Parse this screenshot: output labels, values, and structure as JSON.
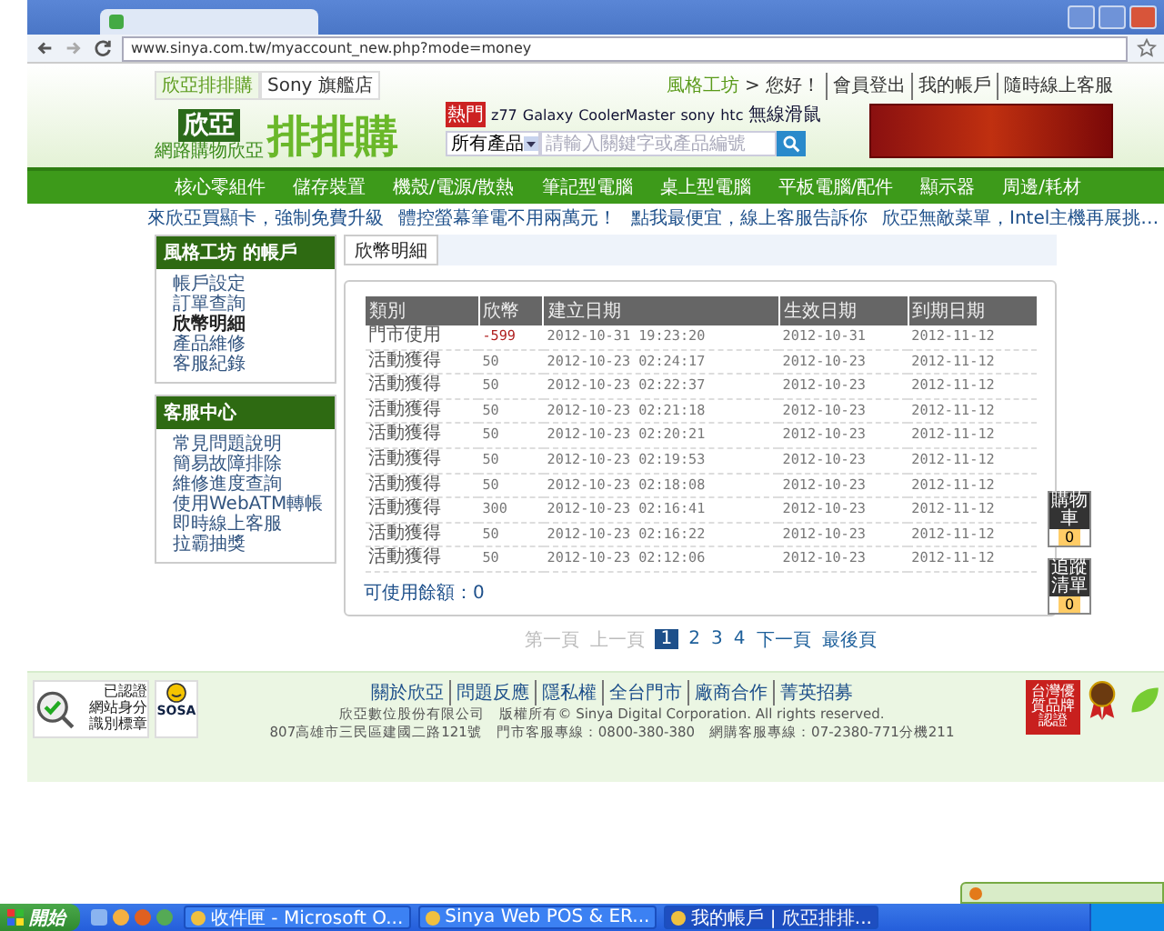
{
  "browser": {
    "url": "www.sinya.com.tw/myaccount_new.php?mode=money"
  },
  "header": {
    "store_tabs": [
      {
        "label": "欣亞排排購",
        "selected": true
      },
      {
        "label": "Sony 旗艦店",
        "selected": false
      }
    ],
    "logo": {
      "mark": "欣亞",
      "name": "排排購",
      "tagline": "網路購物欣亞"
    },
    "user_links": [
      "風格工坊",
      "> 您好！",
      "會員登出",
      "我的帳戶",
      "隨時線上客服"
    ],
    "hot_label": "熱門",
    "hot_keywords": [
      "z77",
      "Galaxy",
      "CoolerMaster",
      "sony",
      "htc",
      "無線滑鼠"
    ],
    "search": {
      "category": "所有產品",
      "placeholder": "請輸入關鍵字或產品編號"
    }
  },
  "nav": [
    "核心零組件",
    "儲存裝置",
    "機殼/電源/散熱",
    "筆記型電腦",
    "桌上型電腦",
    "平板電腦/配件",
    "顯示器",
    "周邊/耗材"
  ],
  "promos": [
    "來欣亞買顯卡，強制免費升級",
    "體控螢幕筆電不用兩萬元！",
    "點我最便宜，線上客服告訴你",
    "欣亞無敵菜單，Intel主機再展挑…"
  ],
  "sidebar": [
    {
      "title": "風格工坊 的帳戶",
      "items": [
        {
          "label": "帳戶設定",
          "selected": false
        },
        {
          "label": "訂單查詢",
          "selected": false
        },
        {
          "label": "欣幣明細",
          "selected": true
        },
        {
          "label": "產品維修",
          "selected": false
        },
        {
          "label": "客服紀錄",
          "selected": false
        }
      ]
    },
    {
      "title": "客服中心",
      "items": [
        {
          "label": "常見問題說明",
          "selected": false
        },
        {
          "label": "簡易故障排除",
          "selected": false
        },
        {
          "label": "維修進度查詢",
          "selected": false
        },
        {
          "label": "使用WebATM轉帳",
          "selected": false
        },
        {
          "label": "即時線上客服",
          "selected": false
        },
        {
          "label": "拉霸抽獎",
          "selected": false
        }
      ]
    }
  ],
  "main": {
    "tab": "欣幣明細",
    "table": {
      "columns": [
        "類別",
        "欣幣",
        "建立日期",
        "生效日期",
        "到期日期"
      ],
      "rows": [
        {
          "cells": [
            "門市使用",
            "-599",
            "2012-10-31 19:23:20",
            "2012-10-31",
            "2012-11-12"
          ],
          "negative": true
        },
        {
          "cells": [
            "活動獲得",
            "50",
            "2012-10-23 02:24:17",
            "2012-10-23",
            "2012-11-12"
          ],
          "negative": false
        },
        {
          "cells": [
            "活動獲得",
            "50",
            "2012-10-23 02:22:37",
            "2012-10-23",
            "2012-11-12"
          ],
          "negative": false
        },
        {
          "cells": [
            "活動獲得",
            "50",
            "2012-10-23 02:21:18",
            "2012-10-23",
            "2012-11-12"
          ],
          "negative": false
        },
        {
          "cells": [
            "活動獲得",
            "50",
            "2012-10-23 02:20:21",
            "2012-10-23",
            "2012-11-12"
          ],
          "negative": false
        },
        {
          "cells": [
            "活動獲得",
            "50",
            "2012-10-23 02:19:53",
            "2012-10-23",
            "2012-11-12"
          ],
          "negative": false
        },
        {
          "cells": [
            "活動獲得",
            "50",
            "2012-10-23 02:18:08",
            "2012-10-23",
            "2012-11-12"
          ],
          "negative": false
        },
        {
          "cells": [
            "活動獲得",
            "300",
            "2012-10-23 02:16:41",
            "2012-10-23",
            "2012-11-12"
          ],
          "negative": false
        },
        {
          "cells": [
            "活動獲得",
            "50",
            "2012-10-23 02:16:22",
            "2012-10-23",
            "2012-11-12"
          ],
          "negative": false
        },
        {
          "cells": [
            "活動獲得",
            "50",
            "2012-10-23 02:12:06",
            "2012-10-23",
            "2012-11-12"
          ],
          "negative": false
        }
      ]
    },
    "balance": "可使用餘額：0"
  },
  "pagination": [
    {
      "label": "第一頁",
      "disabled": true,
      "selected": false
    },
    {
      "label": "上一頁",
      "disabled": true,
      "selected": false
    },
    {
      "label": "1",
      "disabled": false,
      "selected": true
    },
    {
      "label": "2",
      "disabled": false,
      "selected": false
    },
    {
      "label": "3",
      "disabled": false,
      "selected": false
    },
    {
      "label": "4",
      "disabled": false,
      "selected": false
    },
    {
      "label": "下一頁",
      "disabled": false,
      "selected": false
    },
    {
      "label": "最後頁",
      "disabled": false,
      "selected": false
    }
  ],
  "side_widgets": [
    {
      "label": "購物車",
      "count": "0"
    },
    {
      "label": "追蹤清單",
      "count": "0"
    }
  ],
  "footer": {
    "badge_left": {
      "status": "已認證",
      "lines": [
        "網站身分",
        "識別標章"
      ]
    },
    "badge_sosa": "SOSA",
    "links": [
      "關於欣亞",
      "問題反應",
      "隱私權",
      "全台門市",
      "廠商合作",
      "菁英招募"
    ],
    "lines": [
      "欣亞數位股份有限公司　版權所有© Sinya Digital Corporation. All rights reserved.",
      "807高雄市三民區建國二路121號　門市客服專線：0800-380-380　網購客服專線：07-2380-771分機211"
    ],
    "badge_brand": "台灣優質品牌認證"
  },
  "taskbar": {
    "start": "開始",
    "tasks": [
      {
        "label": "收件匣 - Microsoft O...",
        "selected": false
      },
      {
        "label": "Sinya Web POS & ER...",
        "selected": false
      },
      {
        "label": "我的帳戶 | 欣亞排排...",
        "selected": true
      }
    ]
  }
}
